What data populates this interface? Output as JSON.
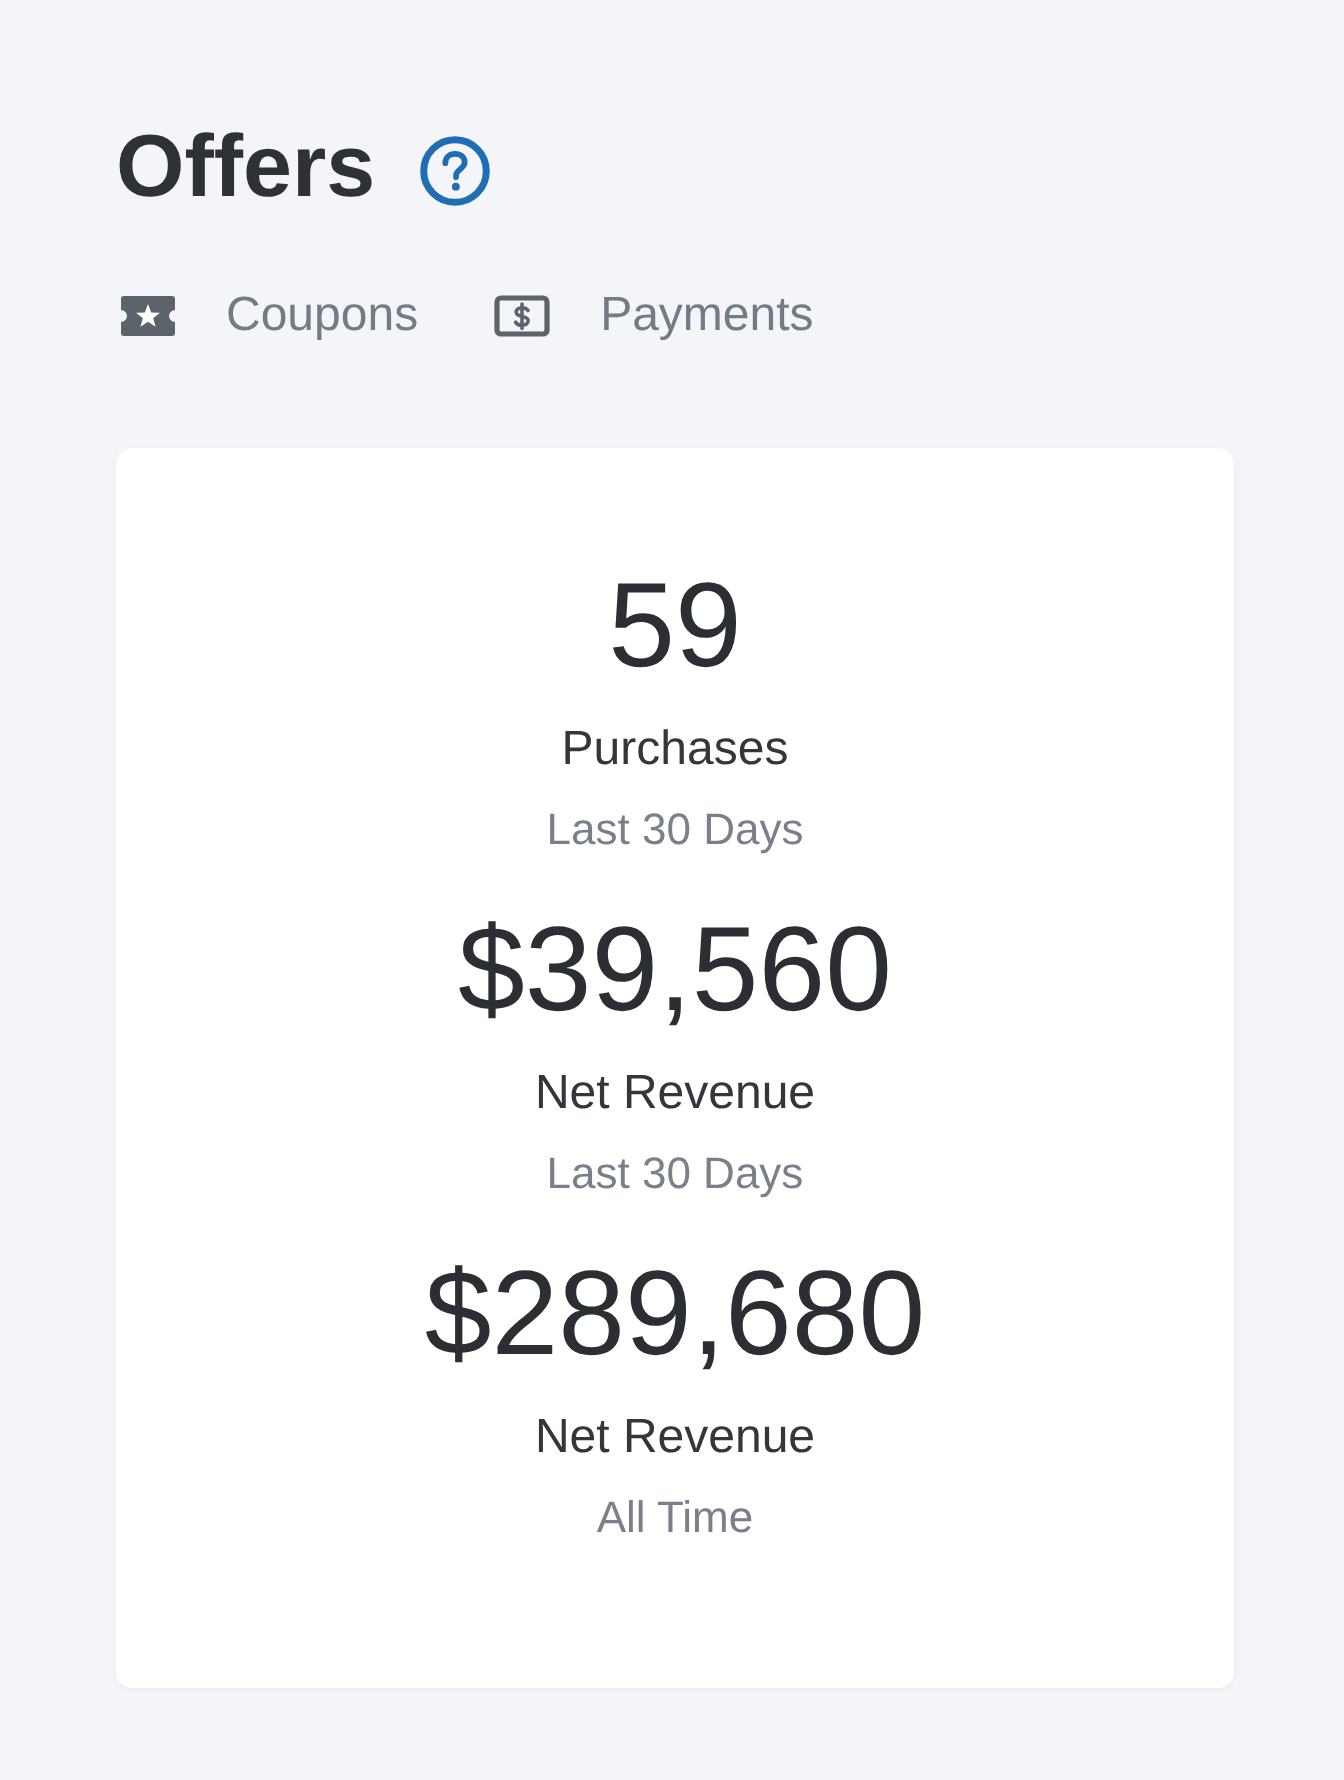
{
  "page": {
    "title": "Offers"
  },
  "links": [
    {
      "kind": "coupon",
      "label": "Coupons"
    },
    {
      "kind": "payment",
      "label": "Payments"
    }
  ],
  "stats": [
    {
      "value": "59",
      "label": "Purchases",
      "period": "Last 30 Days"
    },
    {
      "value": "$39,560",
      "label": "Net Revenue",
      "period": "Last 30 Days"
    },
    {
      "value": "$289,680",
      "label": "Net Revenue",
      "period": "All Time"
    }
  ]
}
